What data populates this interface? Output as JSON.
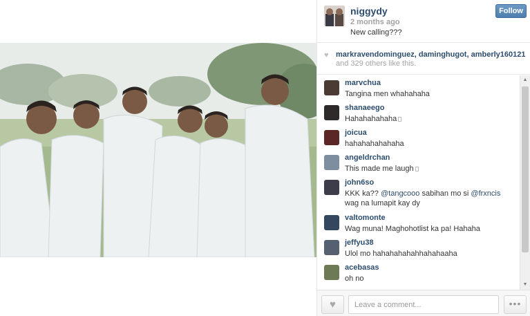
{
  "post": {
    "username": "niggydy",
    "time_ago": "2 months ago",
    "caption": "New calling???",
    "follow_label": "Follow",
    "avatar_icon": "user-avatar"
  },
  "likes": {
    "names": "markravendominguez, daminghugot, amberly160121",
    "others": "and 329 others like this.",
    "heart_icon": "heart-icon"
  },
  "comments": [
    {
      "user": "marvchua",
      "text": "Tangina men whahahaha",
      "avatar_color": "#4a3b35"
    },
    {
      "user": "shanaeego",
      "text": "Hahahahahaha",
      "avatar_color": "#2f2a2a"
    },
    {
      "user": "joicua",
      "text": "hahahahahahaha",
      "avatar_color": "#5a2626"
    },
    {
      "user": "angeldrchan",
      "text": "This made me laugh",
      "avatar_color": "#7d8ea0"
    },
    {
      "user": "john6so",
      "text_before": "KKK ka?? ",
      "mention1": "@tangcooo",
      "text_mid": " sabihan mo si ",
      "mention2": "@frxncis",
      "text_after": " wag na lumapit kay dy",
      "avatar_color": "#3c3c4a"
    },
    {
      "user": "valtomonte",
      "text": "Wag muna! Maghohotlist ka pa! Hahaha",
      "avatar_color": "#33485e"
    },
    {
      "user": "jeffyu38",
      "text": "Ulol mo hahahahahahhahahaaha",
      "avatar_color": "#556070"
    },
    {
      "user": "acebasas",
      "text": "oh no",
      "avatar_color": "#6c7b55"
    }
  ],
  "footer": {
    "comment_placeholder": "Leave a comment...",
    "more_label": "•••"
  },
  "colors": {
    "link": "#2d4d6e",
    "follow_bg": "#4e7eae",
    "muted": "#a3a3a3"
  }
}
